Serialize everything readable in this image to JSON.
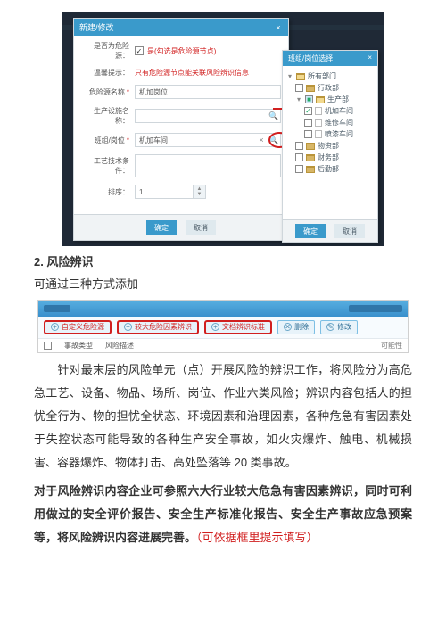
{
  "dialog": {
    "title": "新建/修改",
    "row_is_source_label": "是否为危险源：",
    "row_is_source_check": "✓",
    "row_is_source_text": "是(勾选是危险源节点)",
    "tip_label": "温馨提示：",
    "tip_text": "只有危险源节点能关联风险辨识信息",
    "row_name_label": "危险源名称",
    "row_name_value": "机加岗位",
    "row_area_label": "生产设施名称：",
    "row_area_value": "",
    "row_team_label": "班组/岗位",
    "row_team_value": "机加车间",
    "row_tech_label": "工艺技术条件：",
    "row_tech_value": "",
    "row_order_label": "排序：",
    "row_order_value": "1",
    "btn_ok": "确定",
    "btn_cancel": "取消"
  },
  "tree": {
    "title": "班组/岗位选择",
    "root": "所有部门",
    "n_admin": "行政部",
    "n_prod": "生产部",
    "n_jijia": "机加车间",
    "n_weixiu": "维修车间",
    "n_penqi": "喷漆车间",
    "n_wuzi": "物资部",
    "n_caiwu": "财务部",
    "n_houqin": "后勤部",
    "btn_ok": "确定",
    "btn_cancel": "取消"
  },
  "doc": {
    "heading": "2. 风险辨识",
    "sub": "可通过三种方式添加"
  },
  "toolbar": {
    "b1": "自定义危险源",
    "b2": "较大危险因素辨识",
    "b3": "文档辨识标准",
    "b4": "删除",
    "b5": "修改",
    "col1": "事故类型",
    "col2": "风险描述",
    "col_right": "可能性"
  },
  "para": {
    "t1": "针对最末层的风险单元（点）开展风险的辨识工作，将风险分为高危急工艺、设备、物品、场所、岗位、作业六类风险；辨识内容包括人的担忧全行为、物的担忧全状态、环境因素和治理因素，各种危急有害因素处于失控状态可能导致的各种生产安全事故，如火灾爆炸、触电、机械损害、容器爆炸、物体打击、高处坠落等 20 类事故。",
    "t2a": "对于风险辨识内容企业可参照六大行业较大危急有害因素辨识，同时可利用做过的安全评价报告、安全生产标准化报告、安全生产事故应急预案等，将风险辨识内容进展完善。",
    "t2b": "（可依据框里提示填写）"
  }
}
